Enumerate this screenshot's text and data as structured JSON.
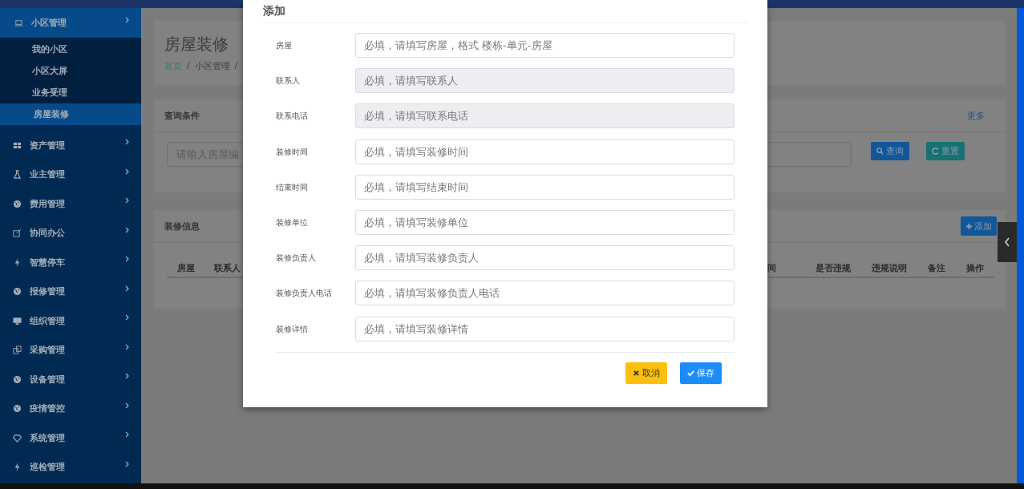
{
  "sidebar": {
    "items": [
      {
        "label": "小区管理",
        "expanded": true,
        "children": [
          {
            "label": "我的小区",
            "selected": false
          },
          {
            "label": "小区大屏",
            "selected": false
          },
          {
            "label": "业务受理",
            "selected": false
          },
          {
            "label": "房屋装修",
            "selected": true
          }
        ]
      },
      {
        "label": "资产管理",
        "expanded": false
      },
      {
        "label": "业主管理",
        "expanded": false
      },
      {
        "label": "费用管理",
        "expanded": false
      },
      {
        "label": "协同办公",
        "expanded": false
      },
      {
        "label": "智慧停车",
        "expanded": false
      },
      {
        "label": "报修管理",
        "expanded": false
      },
      {
        "label": "组织管理",
        "expanded": false
      },
      {
        "label": "采购管理",
        "expanded": false
      },
      {
        "label": "设备管理",
        "expanded": false
      },
      {
        "label": "疫情管控",
        "expanded": false
      },
      {
        "label": "系统管理",
        "expanded": false
      },
      {
        "label": "巡检管理",
        "expanded": false
      }
    ]
  },
  "page": {
    "title": "房屋装修",
    "breadcrumb": [
      "首页",
      "小区管理"
    ],
    "separator": "/"
  },
  "query": {
    "title": "查询条件",
    "more": "更多",
    "placeholder": "请输入房屋编",
    "buttons": [
      {
        "label": "查询",
        "kind": "search"
      },
      {
        "label": "重置",
        "kind": "reset"
      }
    ]
  },
  "table": {
    "title": "装修信息",
    "add_button": "添加",
    "columns_left": [
      "房屋",
      "联系人"
    ],
    "columns_right": [
      "间",
      "是否违规",
      "违规说明",
      "备注",
      "操作"
    ]
  },
  "modal": {
    "title": "添加",
    "fields": [
      {
        "label": "房屋",
        "placeholder": "必填，请填写房屋，格式 楼栋-单元-房屋",
        "disabled": false
      },
      {
        "label": "联系人",
        "placeholder": "必填，请填写联系人",
        "disabled": true
      },
      {
        "label": "联系电话",
        "placeholder": "必填，请填写联系电话",
        "disabled": true
      },
      {
        "label": "装修时间",
        "placeholder": "必填，请填写装修时间",
        "disabled": false
      },
      {
        "label": "结束时间",
        "placeholder": "必填，请填写结束时间",
        "disabled": false
      },
      {
        "label": "装修单位",
        "placeholder": "必填，请填写装修单位",
        "disabled": false
      },
      {
        "label": "装修负责人",
        "placeholder": "必填，请填写装修负责人",
        "disabled": false
      },
      {
        "label": "装修负责人电话",
        "placeholder": "必填，请填写装修负责人电话",
        "disabled": false
      },
      {
        "label": "装修详情",
        "placeholder": "必填，请填写装修详情",
        "disabled": false
      }
    ],
    "buttons": [
      {
        "label": "取消",
        "kind": "cancel"
      },
      {
        "label": "保存",
        "kind": "save"
      }
    ]
  }
}
